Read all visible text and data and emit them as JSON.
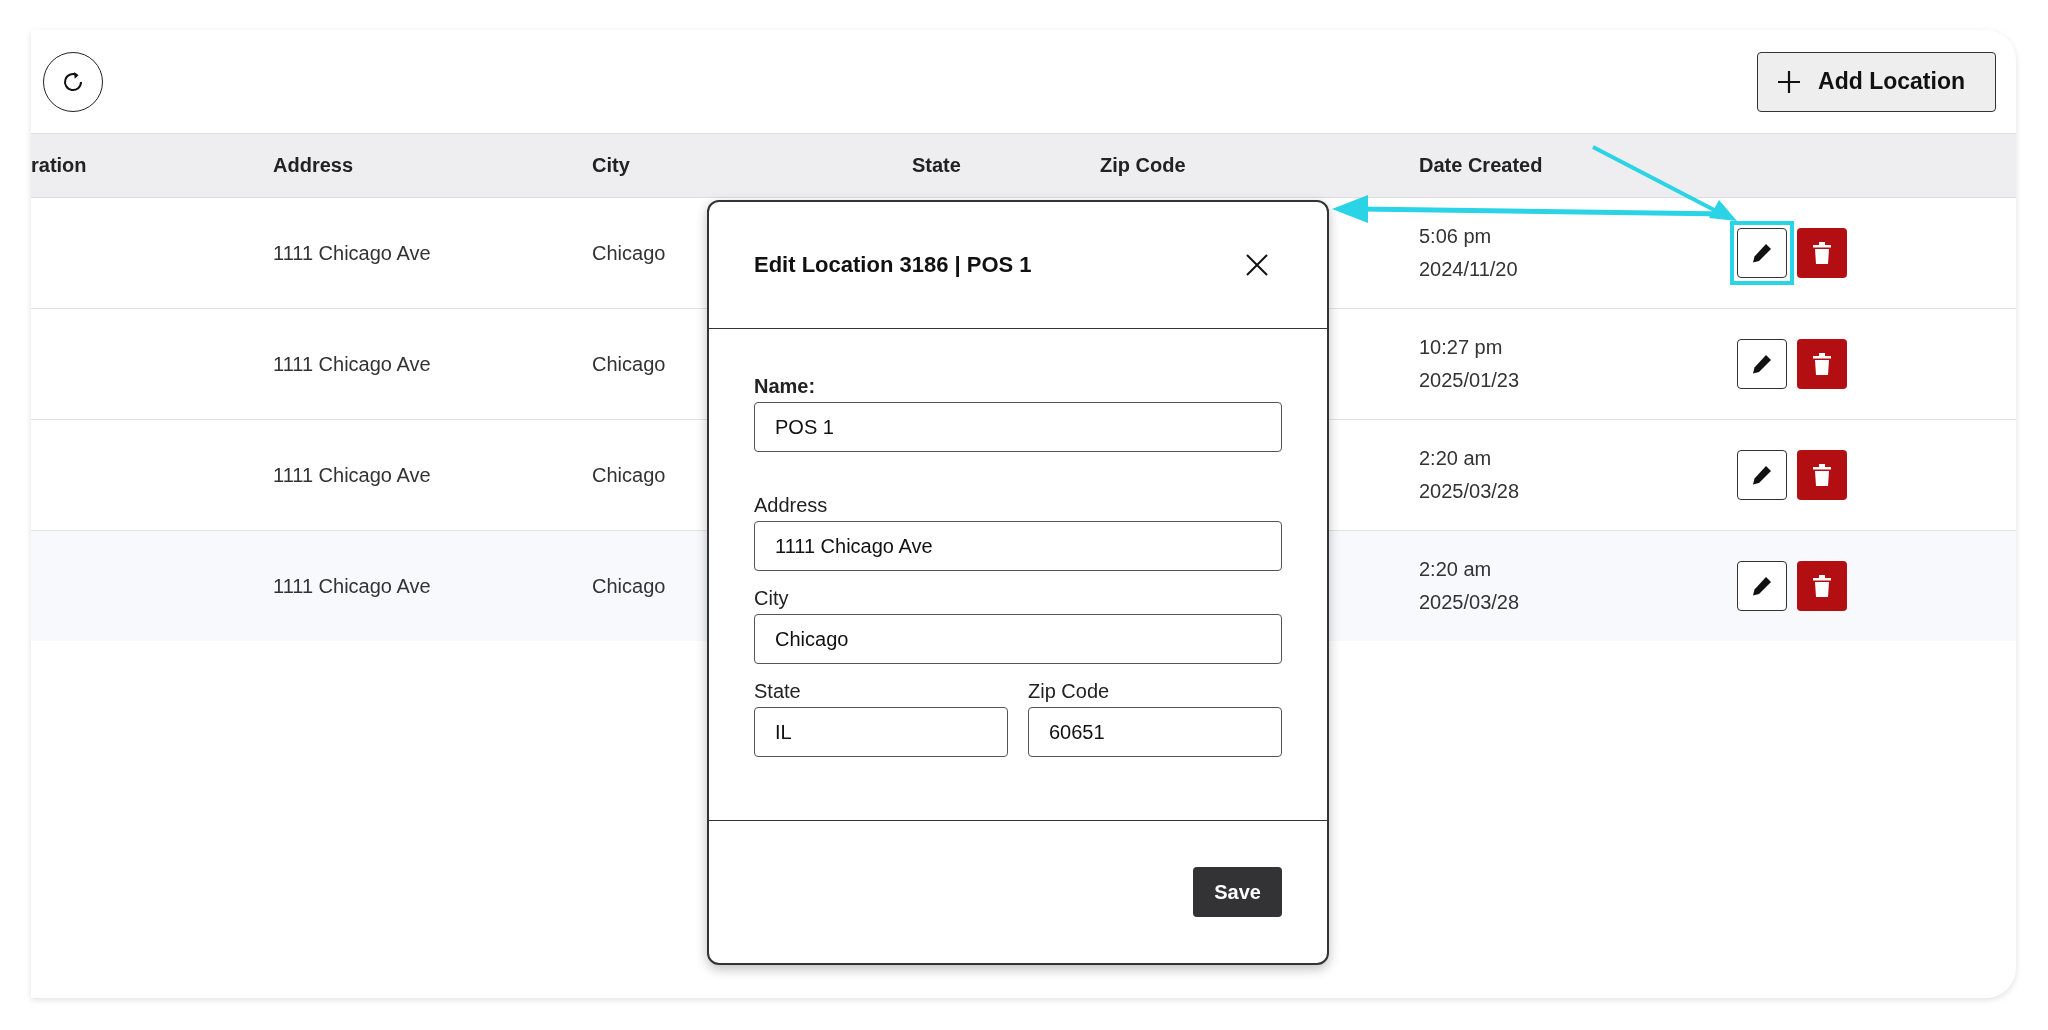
{
  "toolbar": {
    "add_button": "Add Location"
  },
  "table": {
    "columns": [
      "ration",
      "Address",
      "City",
      "State",
      "Zip Code",
      "Date Created"
    ],
    "rows": [
      {
        "address": "1111 Chicago Ave",
        "city": "Chicago",
        "time": "5:06 pm",
        "date": "2024/11/20",
        "hovered": false,
        "annotated": true
      },
      {
        "address": "1111 Chicago Ave",
        "city": "Chicago",
        "time": "10:27 pm",
        "date": "2025/01/23",
        "hovered": false,
        "annotated": false
      },
      {
        "address": "1111 Chicago Ave",
        "city": "Chicago",
        "time": "2:20 am",
        "date": "2025/03/28",
        "hovered": false,
        "annotated": false
      },
      {
        "address": "1111 Chicago Ave",
        "city": "Chicago",
        "time": "2:20 am",
        "date": "2025/03/28",
        "hovered": true,
        "annotated": false
      }
    ]
  },
  "modal": {
    "title": "Edit Location 3186 | POS 1",
    "fields": [
      {
        "label": "Name:",
        "value": "POS 1",
        "kind": "full",
        "emphasized": true
      },
      {
        "label": "Address",
        "value": "1111 Chicago Ave",
        "kind": "full",
        "emphasized": false
      },
      {
        "label": "City",
        "value": "Chicago",
        "kind": "full",
        "emphasized": false
      },
      {
        "label": "State",
        "value": "IL",
        "kind": "half",
        "emphasized": false
      },
      {
        "label": "Zip Code",
        "value": "60651",
        "kind": "half",
        "emphasized": false
      }
    ],
    "save_button": "Save"
  }
}
